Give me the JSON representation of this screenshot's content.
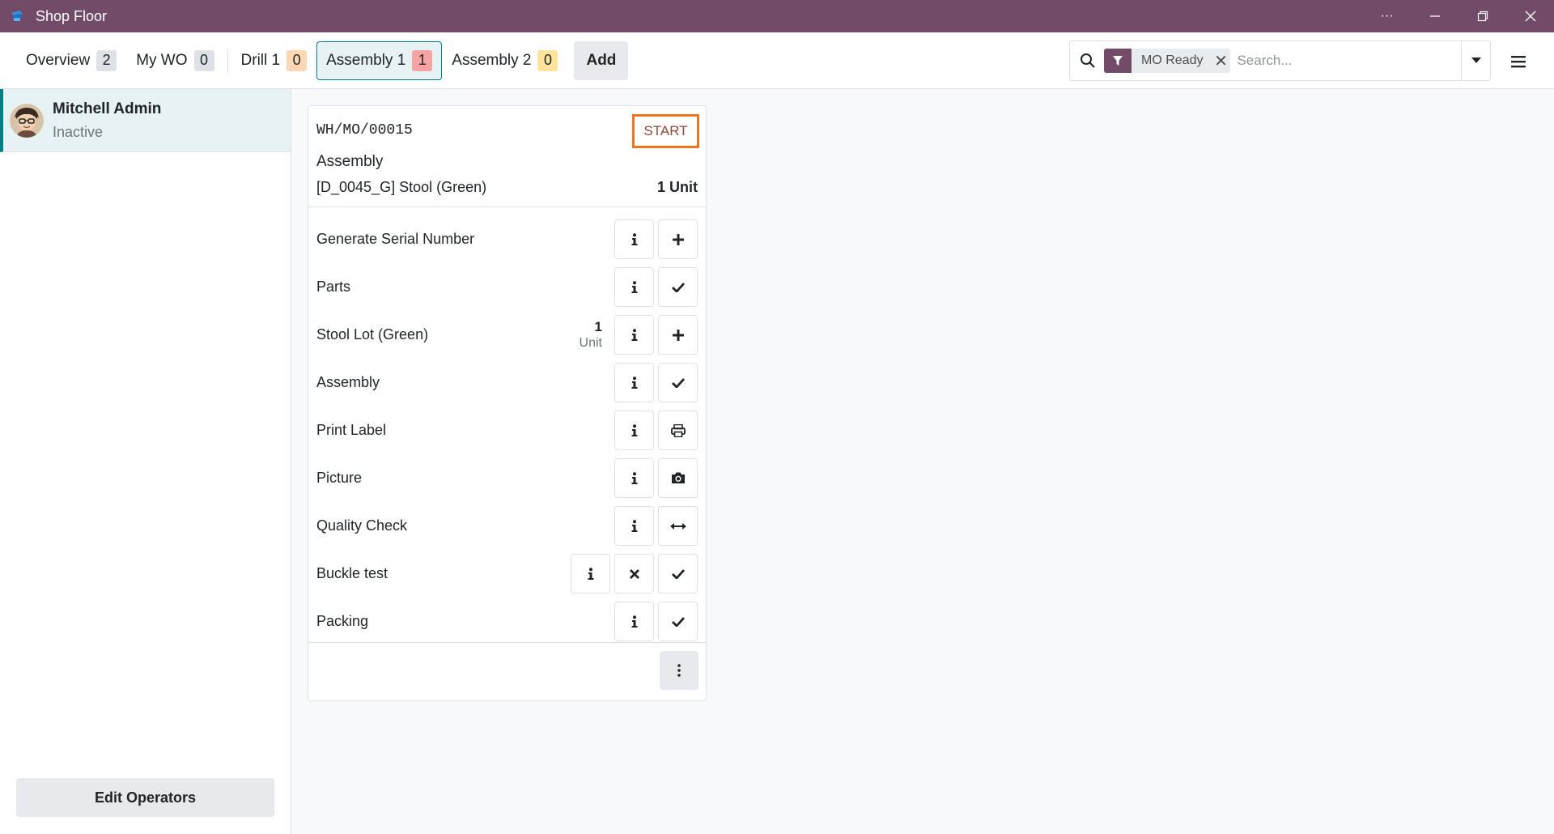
{
  "window": {
    "title": "Shop Floor",
    "controls": [
      "more-icon",
      "minimize-icon",
      "restore-icon",
      "close-icon"
    ]
  },
  "nav": {
    "tabs": [
      {
        "label": "Overview",
        "count": "2",
        "color": "gray"
      },
      {
        "label": "My WO",
        "count": "0",
        "color": "gray"
      },
      {
        "label": "Drill 1",
        "count": "0",
        "color": "orange"
      },
      {
        "label": "Assembly 1",
        "count": "1",
        "color": "red",
        "active": true
      },
      {
        "label": "Assembly 2",
        "count": "0",
        "color": "yellow"
      }
    ],
    "add_label": "Add"
  },
  "search": {
    "facet_label": "MO Ready",
    "placeholder": "Search..."
  },
  "sidebar": {
    "operator_name": "Mitchell Admin",
    "operator_status": "Inactive",
    "edit_label": "Edit Operators"
  },
  "card": {
    "reference": "WH/MO/00015",
    "start_label": "START",
    "workcenter": "Assembly",
    "product": "[D_0045_G] Stool (Green)",
    "quantity": "1 Unit",
    "steps": [
      {
        "label": "Generate Serial Number",
        "action_icon": "plus-icon"
      },
      {
        "label": "Parts",
        "action_icon": "check-icon"
      },
      {
        "label": "Stool Lot (Green)",
        "qty": "1",
        "unit": "Unit",
        "action_icon": "plus-icon"
      },
      {
        "label": "Assembly",
        "action_icon": "check-icon"
      },
      {
        "label": "Print Label",
        "action_icon": "print-icon"
      },
      {
        "label": "Picture",
        "action_icon": "camera-icon"
      },
      {
        "label": "Quality Check",
        "action_icon": "measure-icon"
      },
      {
        "label": "Buckle test",
        "action_icon": "check-icon",
        "extra_icon": "fail-icon"
      },
      {
        "label": "Packing",
        "action_icon": "check-icon"
      }
    ]
  },
  "colors": {
    "titlebar": "#714b67",
    "accent": "#017e84",
    "start_border": "#f0731b"
  }
}
